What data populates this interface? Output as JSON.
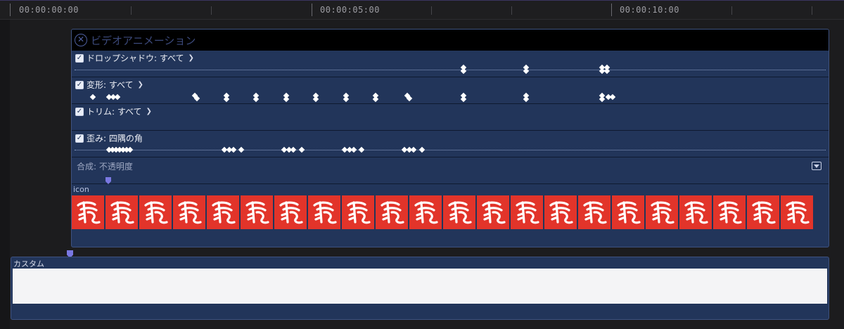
{
  "ruler": {
    "timecodes": [
      "00:00:00:00",
      "00:00:05:00",
      "00:00:10:00"
    ]
  },
  "clip": {
    "close_icon": "circle-x-icon",
    "title": "ビデオアニメーション",
    "rows": [
      {
        "label": "ドロップシャドウ: すべて",
        "checked": true,
        "has_chevron": true
      },
      {
        "label": "変形: すべて",
        "checked": true,
        "has_chevron": true
      },
      {
        "label": "トリム: すべて",
        "checked": true,
        "has_chevron": true
      },
      {
        "label": "歪み: 四隅の角",
        "checked": true,
        "has_chevron": false
      }
    ],
    "composite_label": "合成: 不透明度",
    "icon_label": "icon",
    "frame_count": 22
  },
  "custom_lane": {
    "label": "カスタム"
  },
  "colors": {
    "accent": "#7a78e2",
    "clip_bg": "#22355a",
    "frame_red": "#e2342a"
  }
}
